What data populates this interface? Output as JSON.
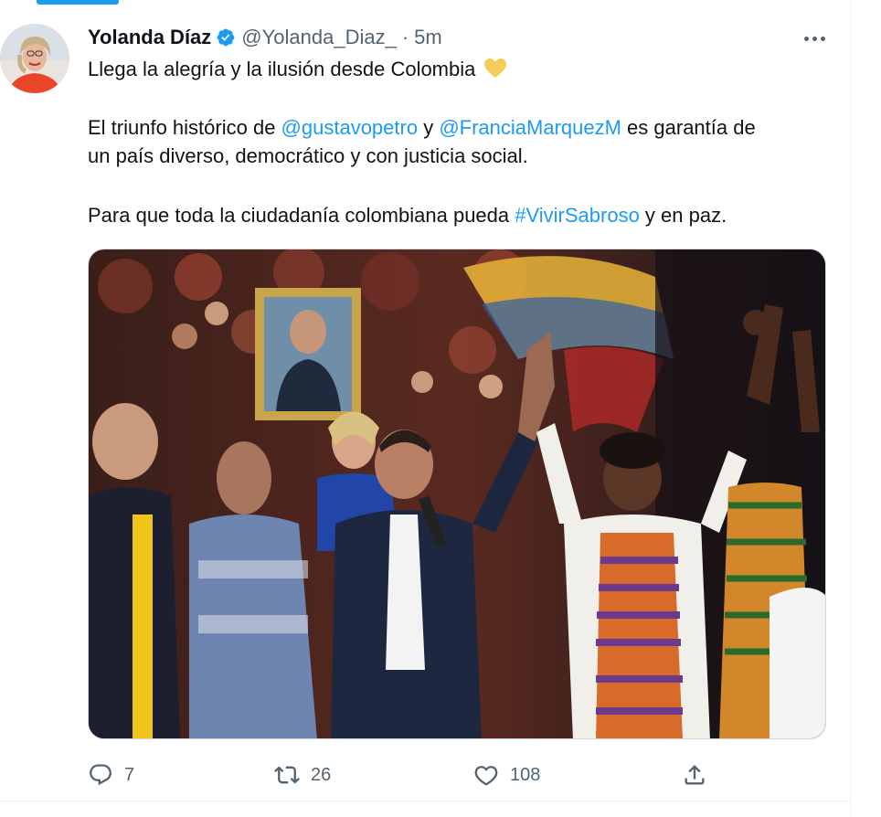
{
  "tweet": {
    "author_name": "Yolanda Díaz",
    "author_handle": "@Yolanda_Diaz_",
    "separator": "·",
    "time": "5m",
    "lines": {
      "l1": "Llega la alegría y la ilusión desde Colombia",
      "l2_a": "El triunfo histórico de ",
      "l2_mention1": "@gustavopetro",
      "l2_b": " y ",
      "l2_mention2": "@FranciaMarquezM",
      "l2_c": " es garantía de",
      "l3": "un país diverso, democrático y con justicia social.",
      "l4_a": "Para que toda la ciudadanía colombiana pueda ",
      "l4_hashtag": "#VivirSabroso",
      "l4_b": " y en paz."
    },
    "emoji": "yellow-heart",
    "actions": {
      "replies": "7",
      "retweets": "26",
      "likes": "108"
    }
  },
  "colors": {
    "link": "#1d9bf0",
    "text": "#0f1419",
    "muted": "#536471",
    "verified": "#1d9bf0",
    "heart_emoji": "#f4cc5a"
  },
  "icons": [
    "verified-badge-icon",
    "more-icon",
    "reply-icon",
    "retweet-icon",
    "like-icon",
    "share-icon"
  ]
}
